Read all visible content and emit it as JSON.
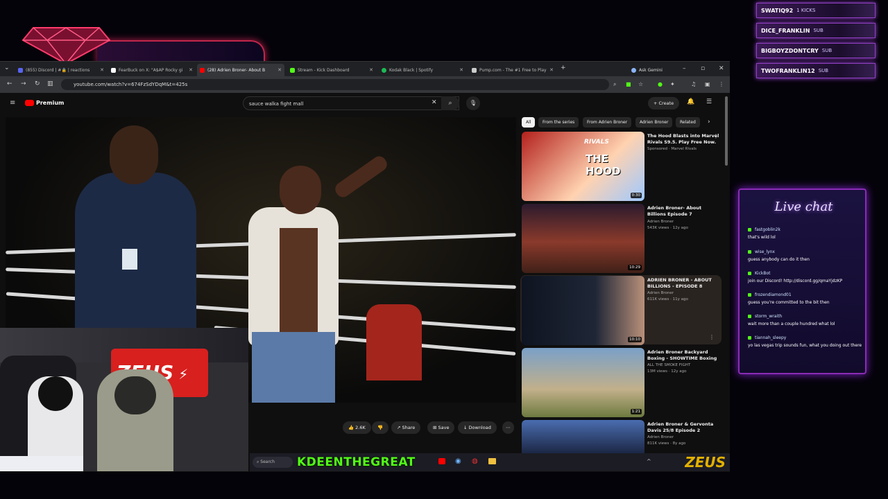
{
  "browser": {
    "tabs": [
      {
        "label": "(855) Discord | #🔒 | reactions",
        "color": "#5865f2"
      },
      {
        "label": "FearBuck on X: \"A$AP Rocky gi",
        "color": "#ffffff"
      },
      {
        "label": "(28) Adrien Broner- About B",
        "color": "#ff0000"
      },
      {
        "label": "Stream - Kick Dashboard",
        "color": "#53fc18"
      },
      {
        "label": "Kodak Black | Spotify",
        "color": "#1db954"
      },
      {
        "label": "Pump.com - The #1 Free to Play",
        "color": "#cccccc"
      }
    ],
    "ask_gemini": "Ask Gemini",
    "url": "youtube.com/watch?v=674FzSdYDqM&t=425s"
  },
  "youtube": {
    "brand": "Premium",
    "search_query": "sauce walka fight mall",
    "create_label": "Create",
    "chips": [
      "All",
      "From the series",
      "From Adrien Broner",
      "Adrien Broner",
      "Related"
    ],
    "actions": {
      "like_count": "2.6K",
      "share": "Share",
      "save": "Save",
      "download": "Download"
    },
    "recommendations": [
      {
        "title": "The Hood Blasts into Marvel Rivals S9.5. Play Free Now.",
        "channel": "Sponsored · Marvel Rivals",
        "meta": "",
        "duration": "0:30",
        "thumb_text": "THE HOOD",
        "thumb_sub": "RIVALS"
      },
      {
        "title": "Adrien Broner- About Billions Episode 7",
        "channel": "Adrien Broner",
        "meta": "543K views · 12y ago",
        "duration": "10:29"
      },
      {
        "title": "ADRIEN BRONER - ABOUT BILLIONS - EPISODE 8",
        "channel": "Adrien Broner",
        "meta": "611K views · 11y ago",
        "duration": "10:10"
      },
      {
        "title": "Adrien Broner Backyard Boxing - SHOWTIME Boxing",
        "channel": "ALL THE SMOKE FIGHT",
        "meta": "13M views · 12y ago",
        "duration": "1:21"
      },
      {
        "title": "Adrien Broner & Gervonta Davis 25/8 Episode 2",
        "channel": "Adrien Broner",
        "meta": "811K views · 8y ago",
        "duration": ""
      }
    ]
  },
  "overlay": {
    "alerts": [
      {
        "user": "SWATIQ92",
        "type": "1 KICKS"
      },
      {
        "user": "DICE_FRANKLIN",
        "type": "SUB"
      },
      {
        "user": "BIGBOYZDONTCRY",
        "type": "SUB"
      },
      {
        "user": "TWOFRANKLIN12",
        "type": "SUB"
      }
    ],
    "streamer_name": "KDEENTHEGREAT",
    "sponsor": "ZEUS",
    "cam_banner": "ZEUS",
    "taskbar_search": "Search"
  },
  "chat": {
    "title": "Live chat",
    "messages": [
      {
        "user": "fastgoblin2k",
        "text": "that's wild lol"
      },
      {
        "user": "wise_lynx",
        "text": "guess anybody can do it then"
      },
      {
        "user": "KickBot",
        "text": "join our Discord! http://discord.gg/qmaYjdzKP"
      },
      {
        "user": "frozendiamond01",
        "text": "guess you're committed to the bit then"
      },
      {
        "user": "storm_wraith",
        "text": "wait more than a couple hundred what lol"
      },
      {
        "user": "tiannah_sleepy",
        "text": "yo las vegas trip sounds fun, what you doing out there"
      }
    ]
  }
}
